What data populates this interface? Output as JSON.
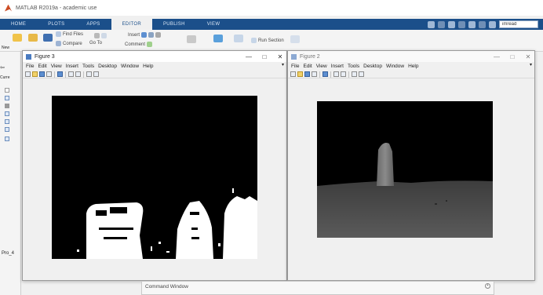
{
  "app": {
    "title": "MATLAB R2019a - academic use"
  },
  "ribbon": {
    "tabs": [
      "HOME",
      "PLOTS",
      "APPS",
      "EDITOR",
      "PUBLISH",
      "VIEW"
    ],
    "active_tab": "EDITOR",
    "search_value": "imread",
    "tools": {
      "find_files": "Find Files",
      "compare": "Compare",
      "go_to": "Go To",
      "insert": "Insert",
      "comment": "Comment",
      "run_section": "Run Section"
    }
  },
  "left_panel": {
    "labels": [
      "New",
      "Curre",
      "Pro_4"
    ]
  },
  "figure3": {
    "title": "Figure 3",
    "menu": [
      "File",
      "Edit",
      "View",
      "Insert",
      "Tools",
      "Desktop",
      "Window",
      "Help"
    ],
    "min": "—",
    "max": "□",
    "close": "✕"
  },
  "figure2": {
    "title": "Figure 2",
    "menu": [
      "File",
      "Edit",
      "View",
      "Insert",
      "Tools",
      "Desktop",
      "Window",
      "Help"
    ],
    "min": "—",
    "max": "□",
    "close": "✕"
  },
  "command_window": {
    "title": "Command Window"
  },
  "colors": {
    "ribbon_blue": "#1b4f8a",
    "figure_bg": "#f0f0f0"
  }
}
